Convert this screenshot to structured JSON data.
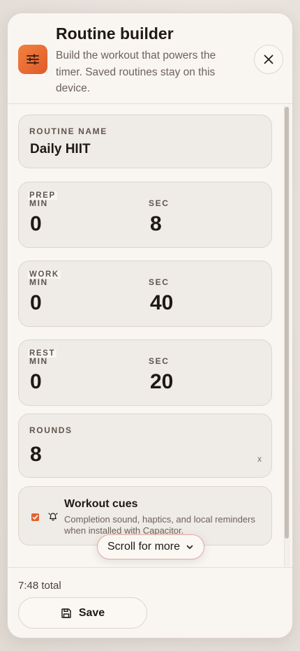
{
  "header": {
    "title": "Routine builder",
    "subtitle": "Build the workout that powers the timer. Saved routines stay on this device.",
    "app_icon": "sliders-icon",
    "close_icon": "close-icon"
  },
  "routine_name": {
    "label": "ROUTINE NAME",
    "value": "Daily HIIT"
  },
  "prep": {
    "label": "PREP",
    "min_label": "MIN",
    "min_value": "0",
    "sec_label": "SEC",
    "sec_value": "8"
  },
  "work": {
    "label": "WORK",
    "min_label": "MIN",
    "min_value": "0",
    "sec_label": "SEC",
    "sec_value": "40"
  },
  "rest": {
    "label": "REST",
    "min_label": "MIN",
    "min_value": "0",
    "sec_label": "SEC",
    "sec_value": "20"
  },
  "rounds": {
    "label": "ROUNDS",
    "value": "8",
    "unit": "x"
  },
  "cues": {
    "checked": true,
    "title": "Workout cues",
    "description": "Completion sound, haptics, and local reminders when installed with Capacitor.",
    "icon": "bell-icon"
  },
  "scroll_hint": {
    "label": "Scroll for more",
    "icon": "chevron-down-icon"
  },
  "footer": {
    "total": "7:48 total",
    "save_label": "Save",
    "save_icon": "save-icon"
  },
  "colors": {
    "accent": "#e8682f",
    "background": "#f9f6f2",
    "card": "#efebe6"
  }
}
